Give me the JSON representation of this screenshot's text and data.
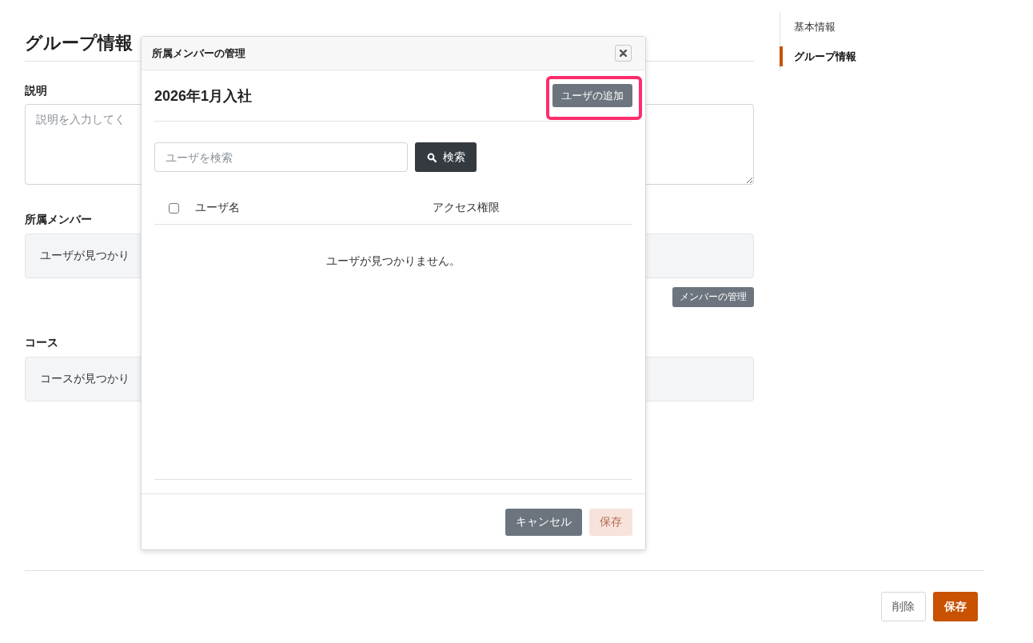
{
  "page": {
    "title": "グループ情報",
    "description": {
      "label": "説明",
      "placeholder": "説明を入力してく"
    },
    "members": {
      "label": "所属メンバー",
      "empty_text": "ユーザが見つかり",
      "manage_button": "メンバーの管理"
    },
    "courses": {
      "label": "コース",
      "empty_text": "コースが見つかり"
    }
  },
  "side_nav": {
    "items": [
      {
        "label": "基本情報",
        "selected": false
      },
      {
        "label": "グループ情報",
        "selected": true
      }
    ]
  },
  "footer": {
    "buttons": [
      {
        "label": "削除",
        "kind": "outline"
      },
      {
        "label": "保存",
        "kind": "primary"
      }
    ]
  },
  "dialog": {
    "title": "所属メンバーの管理",
    "group_name": "2026年1月入社",
    "add_button": {
      "label": "ユーザの追加",
      "highlighted": true
    },
    "search": {
      "placeholder": "ユーザを検索",
      "button": "検索"
    },
    "table": {
      "select_all_checked": false,
      "columns": [
        "ユーザ名",
        "アクセス権限"
      ],
      "empty_text": "ユーザが見つかりません。"
    },
    "buttons": [
      {
        "label": "キャンセル",
        "kind": "secondary",
        "disabled": false
      },
      {
        "label": "保存",
        "kind": "primary",
        "disabled": true
      }
    ]
  }
}
